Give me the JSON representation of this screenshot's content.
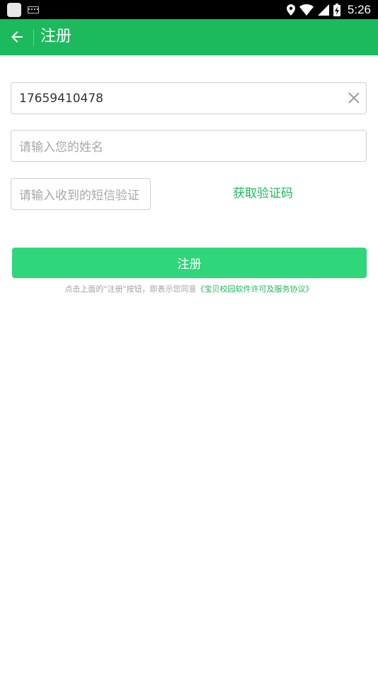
{
  "status_bar": {
    "time": "5:26",
    "icons": [
      "app-icon",
      "keyboard-icon",
      "location-icon",
      "wifi-icon",
      "signal-icon",
      "battery-charging-icon"
    ]
  },
  "toolbar": {
    "title": "注册",
    "back_icon": "arrow-left-icon",
    "background": "#1cba5c"
  },
  "form": {
    "phone": {
      "value": "17659410478",
      "clear_icon": "close-icon"
    },
    "name": {
      "placeholder": "请输入您的姓名"
    },
    "sms_code": {
      "placeholder": "请输入收到的短信验证"
    },
    "get_code_label": "获取验证码",
    "submit_label": "注册"
  },
  "agreement": {
    "prefix": "点击上面的\"注册\"按钮，即表示您同意",
    "link": "《宝贝校园软件许可及服务协议》"
  },
  "colors": {
    "accent": "#1cba5c",
    "button": "#2fd67a"
  }
}
